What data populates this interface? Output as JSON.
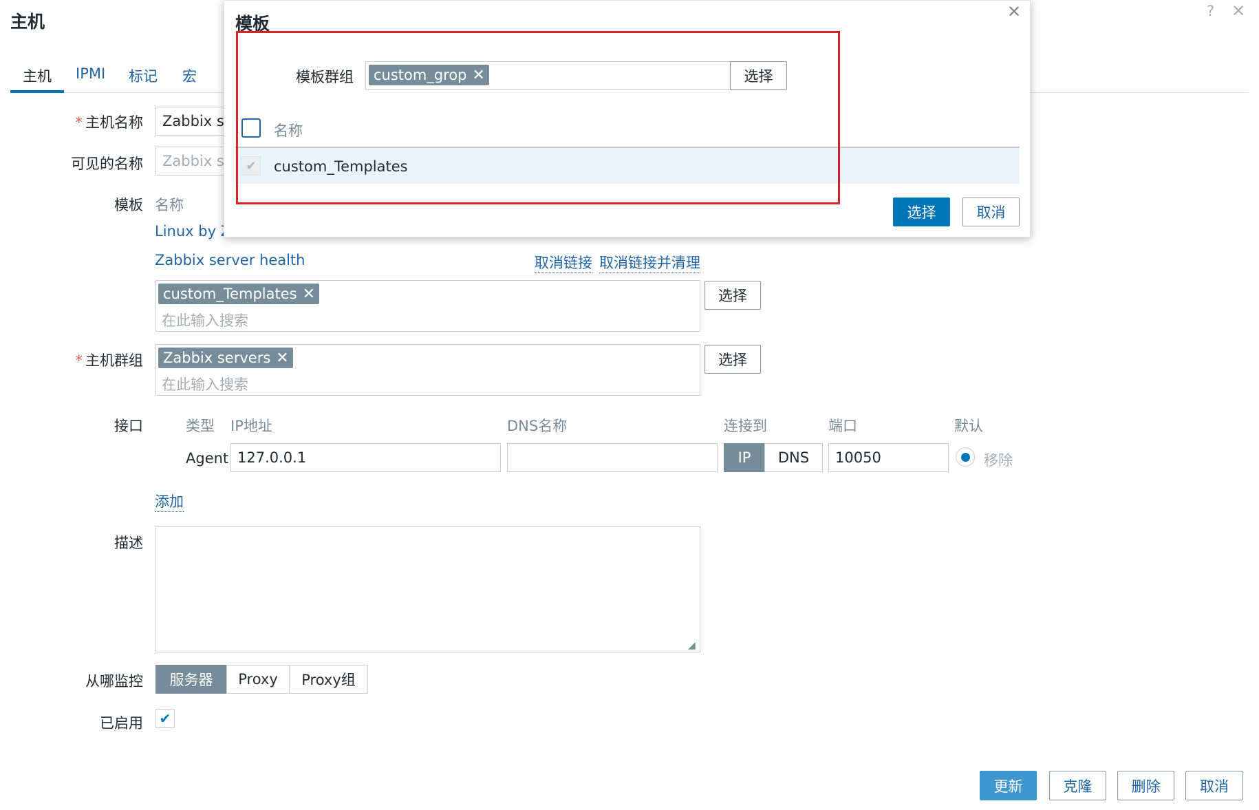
{
  "page": {
    "title": "主机",
    "help_icon": "question-mark",
    "close_icon": "close-x"
  },
  "tabs": [
    {
      "label": "主机",
      "active": true
    },
    {
      "label": "IPMI",
      "active": false
    },
    {
      "label": "标记",
      "active": false
    },
    {
      "label": "宏",
      "active": false
    }
  ],
  "form": {
    "host_name_label": "主机名称",
    "host_name_value": "Zabbix se",
    "visible_name_label": "可见的名称",
    "visible_name_value": "Zabbix se",
    "templates_label": "模板",
    "templates_col_name": "名称",
    "linked_templates": [
      {
        "name": "Linux by Z",
        "unlink": "取消链接",
        "unlink_clear": "取消链接并清理"
      },
      {
        "name": "Zabbix server health",
        "unlink": "取消链接",
        "unlink_clear": "取消链接并清理"
      }
    ],
    "template_tag": "custom_Templates",
    "template_search_placeholder": "在此输入搜索",
    "template_select_button": "选择",
    "host_groups_label": "主机群组",
    "host_group_tag": "Zabbix servers",
    "host_group_search_placeholder": "在此输入搜索",
    "host_group_select_button": "选择",
    "interfaces_label": "接口",
    "interface_headers": {
      "type": "类型",
      "ip": "IP地址",
      "dns": "DNS名称",
      "connect": "连接到",
      "port": "端口",
      "default": "默认"
    },
    "interface_row": {
      "type": "Agent",
      "ip": "127.0.0.1",
      "dns": "",
      "connect_ip": "IP",
      "connect_dns": "DNS",
      "port": "10050",
      "remove": "移除"
    },
    "add_link": "添加",
    "description_label": "描述",
    "monitored_by_label": "从哪监控",
    "monitored_by_options": [
      "服务器",
      "Proxy",
      "Proxy组"
    ],
    "enabled_label": "已启用",
    "enabled": true
  },
  "footer_buttons": {
    "update": "更新",
    "clone": "克隆",
    "delete": "删除",
    "cancel": "取消"
  },
  "modal": {
    "title": "模板",
    "group_label": "模板群组",
    "group_tag": "custom_grop",
    "group_select_button": "选择",
    "column_name": "名称",
    "rows": [
      {
        "name": "custom_Templates",
        "checked": true,
        "disabled": true
      }
    ],
    "select_button": "选择",
    "cancel_button": "取消"
  },
  "colors": {
    "accent": "#0275b8",
    "link": "#1f65a6",
    "tag_bg": "#768d99",
    "highlight_box": "#d8222a",
    "row_selected": "#e8f5ff"
  }
}
